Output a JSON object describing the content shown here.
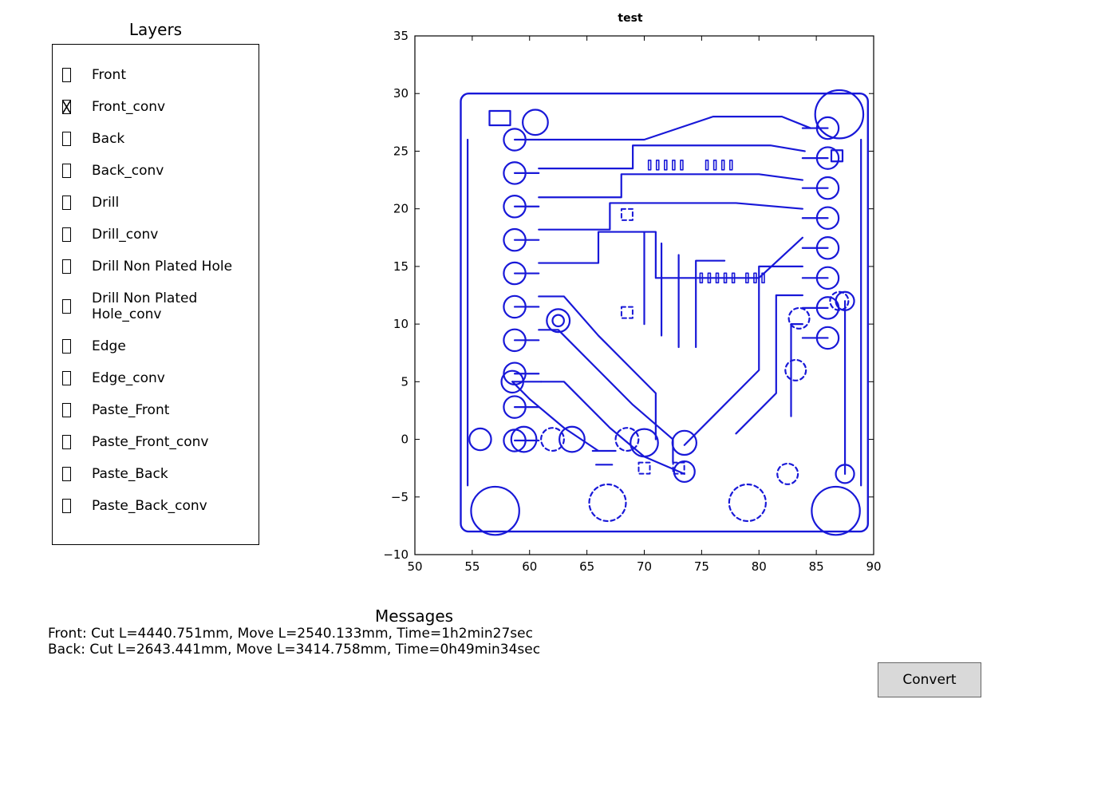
{
  "layers": {
    "title": "Layers",
    "items": [
      {
        "label": "Front",
        "checked": false
      },
      {
        "label": "Front_conv",
        "checked": true
      },
      {
        "label": "Back",
        "checked": false
      },
      {
        "label": "Back_conv",
        "checked": false
      },
      {
        "label": "Drill",
        "checked": false
      },
      {
        "label": "Drill_conv",
        "checked": false
      },
      {
        "label": "Drill Non Plated Hole",
        "checked": false
      },
      {
        "label": "Drill Non Plated Hole_conv",
        "checked": false
      },
      {
        "label": "Edge",
        "checked": false
      },
      {
        "label": "Edge_conv",
        "checked": false
      },
      {
        "label": "Paste_Front",
        "checked": false
      },
      {
        "label": "Paste_Front_conv",
        "checked": false
      },
      {
        "label": "Paste_Back",
        "checked": false
      },
      {
        "label": "Paste_Back_conv",
        "checked": false
      }
    ]
  },
  "chart_data": {
    "type": "scatter",
    "title": "test",
    "xlabel": "",
    "ylabel": "",
    "xlim": [
      50,
      90
    ],
    "ylim": [
      -10,
      35
    ],
    "x_ticks": [
      50,
      55,
      60,
      65,
      70,
      75,
      80,
      85,
      90
    ],
    "y_ticks": [
      -10,
      -5,
      0,
      5,
      10,
      15,
      20,
      25,
      30,
      35
    ],
    "description": "PCB front copper layer toolpath outline (Front_conv) drawn in blue: rounded rectangular board outline approx 55..89 mm X, -8..30 mm Y; four corner mounting-hole circles near (56,-6),(88,-6),(88,29),(56,29); two vertical rows of pads on left (x≈58..60, y≈0..27) and right (x≈84..87, y≈8..28) connected by routed traces; dense trace routing in upper-middle region with small SMD pad clusters near (72,24),(80,24),(76,14); several dashed via circles near (62,0),(70,0),(82,-3),(79,-5),(65,-5),(83,6),(85,11),(87,12),(69,11),(66,1).",
    "stroke_color": "#1818d8"
  },
  "messages": {
    "title": "Messages",
    "lines": [
      "Front: Cut L=4440.751mm, Move L=2540.133mm, Time=1h2min27sec",
      "Back: Cut L=2643.441mm, Move L=3414.758mm, Time=0h49min34sec"
    ]
  },
  "buttons": {
    "convert": "Convert"
  }
}
